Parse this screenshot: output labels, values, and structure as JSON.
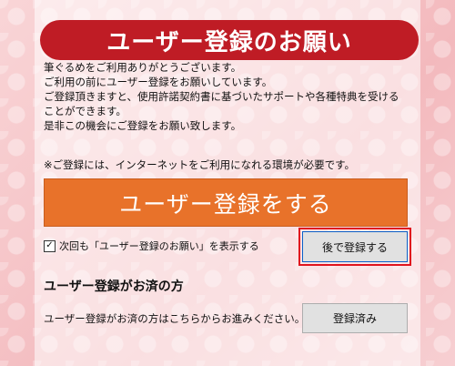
{
  "header": {
    "title": "ユーザー登録のお願い"
  },
  "intro": {
    "lines": [
      "筆ぐるめをご利用ありがとうございます。",
      "ご利用の前にユーザー登録をお願いしています。",
      "ご登録頂きますと、使用許諾契約書に基づいたサポートや各種特典を受ける",
      "ことができます。",
      "是非この機会にご登録をお願い致します。"
    ]
  },
  "notice": "※ご登録には、インターネットをご利用になれる環境が必要です。",
  "register_button": {
    "label": "ユーザー登録をする"
  },
  "show_again": {
    "label": "次回も「ユーザー登録のお願い」を表示する",
    "checked": true
  },
  "later_button": {
    "label": "後で登録する"
  },
  "registered_section": {
    "heading": "ユーザー登録がお済の方",
    "text": "ユーザー登録がお済の方はこちらからお進みください。",
    "button_label": "登録済み"
  },
  "colors": {
    "title_bg": "#bf1c25",
    "primary_button": "#e8722a",
    "highlight_outline": "#e0141e"
  }
}
